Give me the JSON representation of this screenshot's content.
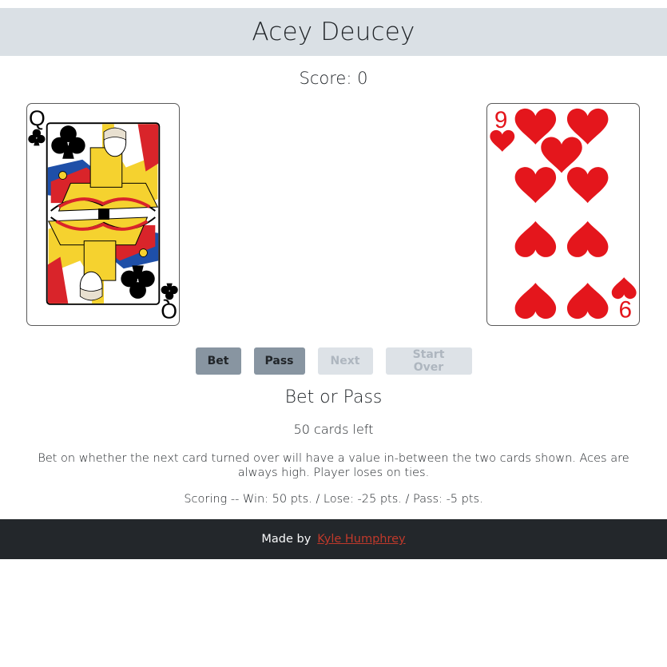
{
  "header": {
    "title": "Acey Deucey"
  },
  "score": {
    "text": "Score: 0"
  },
  "cards": {
    "left": {
      "rank": "Q",
      "suit": "clubs",
      "color": "#000000",
      "icon": "queen-of-clubs-card"
    },
    "right": {
      "rank": "9",
      "suit": "hearts",
      "color": "#e4161c",
      "icon": "nine-of-hearts-card"
    }
  },
  "buttons": {
    "bet": "Bet",
    "pass": "Pass",
    "next": "Next",
    "start_over": "Start Over"
  },
  "status": {
    "message": "Bet or Pass",
    "cards_left": "50 cards left",
    "description": "Bet on whether the next card turned over will have a value in-between the two cards shown. Aces are always high. Player loses on ties.",
    "scoring": "Scoring -- Win: 50 pts. / Lose: -25 pts. / Pass: -5 pts."
  },
  "footer": {
    "made_by": "Made by",
    "author": "Kyle Humphrey"
  }
}
